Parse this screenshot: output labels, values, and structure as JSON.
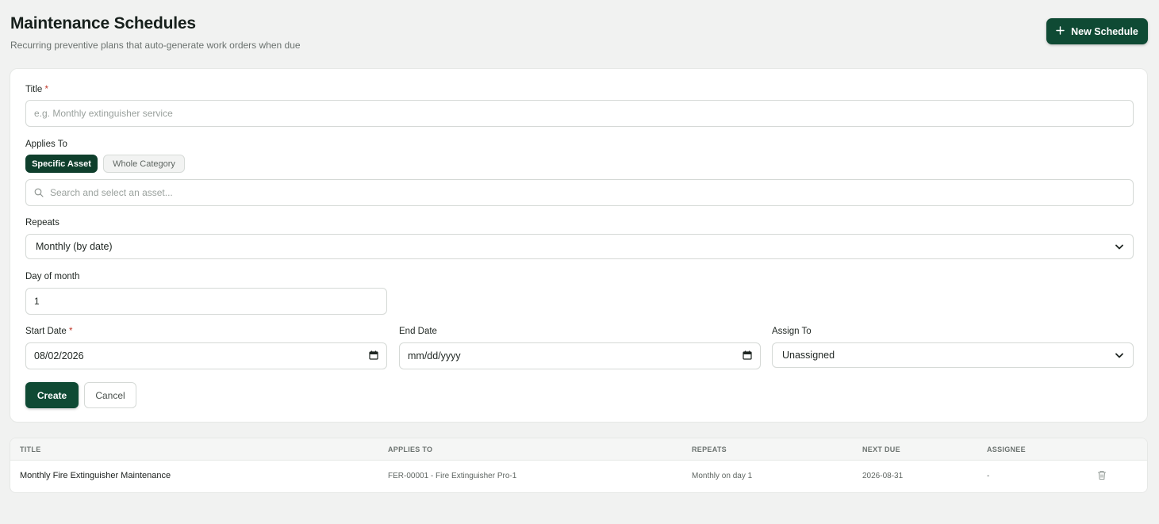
{
  "header": {
    "title": "Maintenance Schedules",
    "subtitle": "Recurring preventive plans that auto-generate work orders when due",
    "new_button_label": "New Schedule"
  },
  "form": {
    "title_label": "Title",
    "required_mark": "*",
    "title_placeholder": "e.g. Monthly extinguisher service",
    "applies_to_label": "Applies To",
    "applies_to_options": [
      "Specific Asset",
      "Whole Category"
    ],
    "applies_to_selected": "Specific Asset",
    "asset_search_placeholder": "Search and select an asset...",
    "repeats_label": "Repeats",
    "repeats_value": "Monthly (by date)",
    "day_of_month_label": "Day of month",
    "day_of_month_value": "1",
    "start_date_label": "Start Date",
    "start_date_value": "08/02/2026",
    "end_date_label": "End Date",
    "end_date_placeholder": "mm/dd/yyyy",
    "assign_to_label": "Assign To",
    "assign_to_value": "Unassigned",
    "create_label": "Create",
    "cancel_label": "Cancel"
  },
  "table": {
    "columns": [
      "TITLE",
      "APPLIES TO",
      "REPEATS",
      "NEXT DUE",
      "ASSIGNEE"
    ],
    "rows": [
      {
        "title": "Monthly Fire Extinguisher Maintenance",
        "applies_to": "FER-00001 - Fire Extinguisher Pro-1",
        "repeats": "Monthly on day 1",
        "next_due": "2026-08-31",
        "assignee": "-"
      }
    ]
  },
  "colors": {
    "primary": "#0f4a34",
    "background": "#f1f2f1",
    "required": "#c0392b"
  }
}
